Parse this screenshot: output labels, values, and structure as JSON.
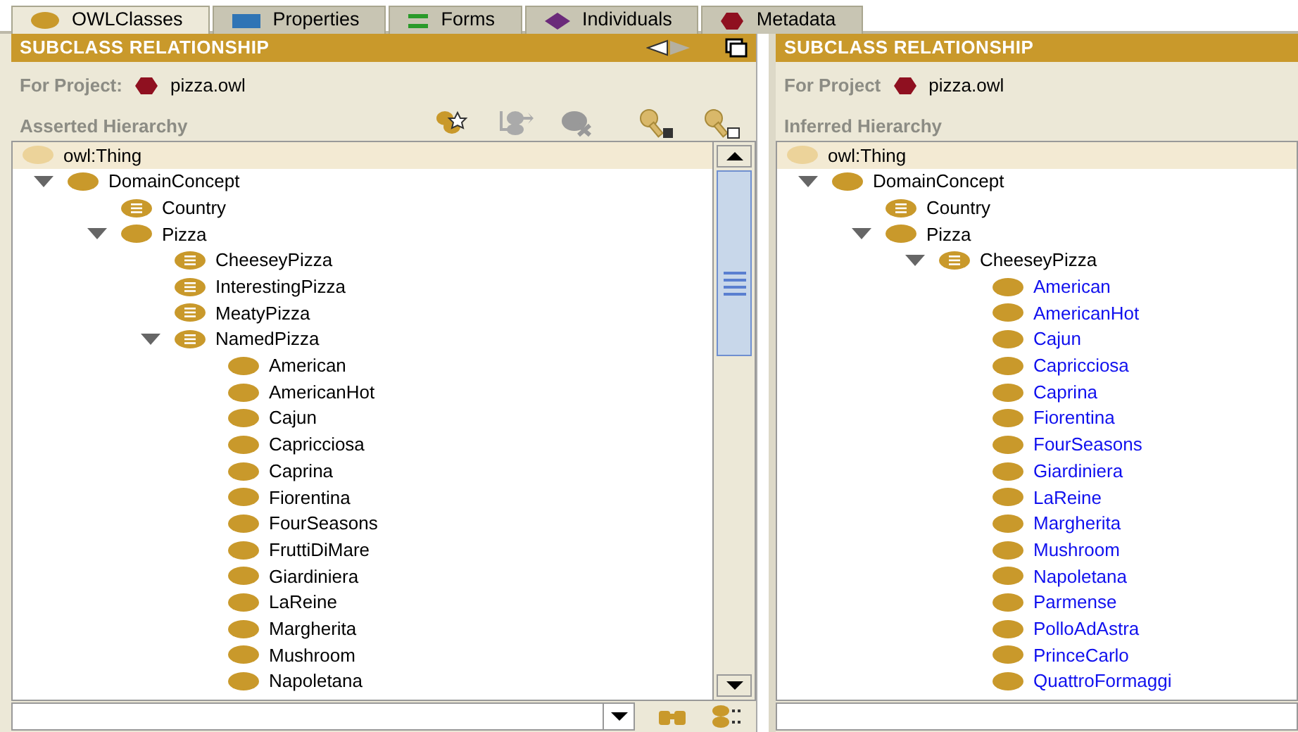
{
  "tabs": [
    {
      "label": "OWLClasses",
      "kind": "classes",
      "selected": true
    },
    {
      "label": "Properties",
      "kind": "properties",
      "selected": false
    },
    {
      "label": "Forms",
      "kind": "forms",
      "selected": false
    },
    {
      "label": "Individuals",
      "kind": "individuals",
      "selected": false
    },
    {
      "label": "Metadata",
      "kind": "metadata",
      "selected": false
    }
  ],
  "left_panel": {
    "title": "SUBCLASS RELATIONSHIP",
    "project_label": "For Project:",
    "project": "pizza.owl",
    "hierarchy_label": "Asserted Hierarchy",
    "tree": [
      {
        "label": "owl:Thing",
        "kind": "root",
        "selected": true,
        "children": [
          {
            "label": "DomainConcept",
            "kind": "primitive",
            "selected": false,
            "expanded": true,
            "children": [
              {
                "label": "Country",
                "kind": "defined",
                "selected": false
              },
              {
                "label": "Pizza",
                "kind": "primitive",
                "selected": false,
                "expanded": true,
                "children": [
                  {
                    "label": "CheeseyPizza",
                    "kind": "defined",
                    "selected": false
                  },
                  {
                    "label": "InterestingPizza",
                    "kind": "defined",
                    "selected": false
                  },
                  {
                    "label": "MeatyPizza",
                    "kind": "defined",
                    "selected": false
                  },
                  {
                    "label": "NamedPizza",
                    "kind": "defined",
                    "selected": false,
                    "expanded": true,
                    "children": [
                      {
                        "label": "American",
                        "kind": "primitive",
                        "selected": false
                      },
                      {
                        "label": "AmericanHot",
                        "kind": "primitive",
                        "selected": false
                      },
                      {
                        "label": "Cajun",
                        "kind": "primitive",
                        "selected": false
                      },
                      {
                        "label": "Capricciosa",
                        "kind": "primitive",
                        "selected": false
                      },
                      {
                        "label": "Caprina",
                        "kind": "primitive",
                        "selected": false
                      },
                      {
                        "label": "Fiorentina",
                        "kind": "primitive",
                        "selected": false
                      },
                      {
                        "label": "FourSeasons",
                        "kind": "primitive",
                        "selected": false
                      },
                      {
                        "label": "FruttiDiMare",
                        "kind": "primitive",
                        "selected": false
                      },
                      {
                        "label": "Giardiniera",
                        "kind": "primitive",
                        "selected": false
                      },
                      {
                        "label": "LaReine",
                        "kind": "primitive",
                        "selected": false
                      },
                      {
                        "label": "Margherita",
                        "kind": "primitive",
                        "selected": false
                      },
                      {
                        "label": "Mushroom",
                        "kind": "primitive",
                        "selected": false
                      },
                      {
                        "label": "Napoletana",
                        "kind": "primitive",
                        "selected": false
                      }
                    ]
                  }
                ]
              }
            ]
          }
        ]
      }
    ]
  },
  "right_panel": {
    "title": "SUBCLASS RELATIONSHIP",
    "project_label": "For Project",
    "project": "pizza.owl",
    "hierarchy_label": "Inferred Hierarchy",
    "tree": [
      {
        "label": "owl:Thing",
        "kind": "root",
        "selected": true,
        "children": [
          {
            "label": "DomainConcept",
            "kind": "primitive",
            "selected": false,
            "expanded": true,
            "children": [
              {
                "label": "Country",
                "kind": "defined",
                "selected": false
              },
              {
                "label": "Pizza",
                "kind": "primitive",
                "selected": false,
                "expanded": true,
                "children": [
                  {
                    "label": "CheeseyPizza",
                    "kind": "defined",
                    "selected": false,
                    "expanded": true,
                    "children": [
                      {
                        "label": "American",
                        "kind": "primitive",
                        "selected": false,
                        "changed": true
                      },
                      {
                        "label": "AmericanHot",
                        "kind": "primitive",
                        "selected": false,
                        "changed": true
                      },
                      {
                        "label": "Cajun",
                        "kind": "primitive",
                        "selected": false,
                        "changed": true
                      },
                      {
                        "label": "Capricciosa",
                        "kind": "primitive",
                        "selected": false,
                        "changed": true
                      },
                      {
                        "label": "Caprina",
                        "kind": "primitive",
                        "selected": false,
                        "changed": true
                      },
                      {
                        "label": "Fiorentina",
                        "kind": "primitive",
                        "selected": false,
                        "changed": true
                      },
                      {
                        "label": "FourSeasons",
                        "kind": "primitive",
                        "selected": false,
                        "changed": true
                      },
                      {
                        "label": "Giardiniera",
                        "kind": "primitive",
                        "selected": false,
                        "changed": true
                      },
                      {
                        "label": "LaReine",
                        "kind": "primitive",
                        "selected": false,
                        "changed": true
                      },
                      {
                        "label": "Margherita",
                        "kind": "primitive",
                        "selected": false,
                        "changed": true
                      },
                      {
                        "label": "Mushroom",
                        "kind": "primitive",
                        "selected": false,
                        "changed": true
                      },
                      {
                        "label": "Napoletana",
                        "kind": "primitive",
                        "selected": false,
                        "changed": true
                      },
                      {
                        "label": "Parmense",
                        "kind": "primitive",
                        "selected": false,
                        "changed": true
                      },
                      {
                        "label": "PolloAdAstra",
                        "kind": "primitive",
                        "selected": false,
                        "changed": true
                      },
                      {
                        "label": "PrinceCarlo",
                        "kind": "primitive",
                        "selected": false,
                        "changed": true
                      },
                      {
                        "label": "QuattroFormaggi",
                        "kind": "primitive",
                        "selected": false,
                        "changed": true
                      }
                    ]
                  }
                ]
              }
            ]
          }
        ]
      }
    ]
  }
}
